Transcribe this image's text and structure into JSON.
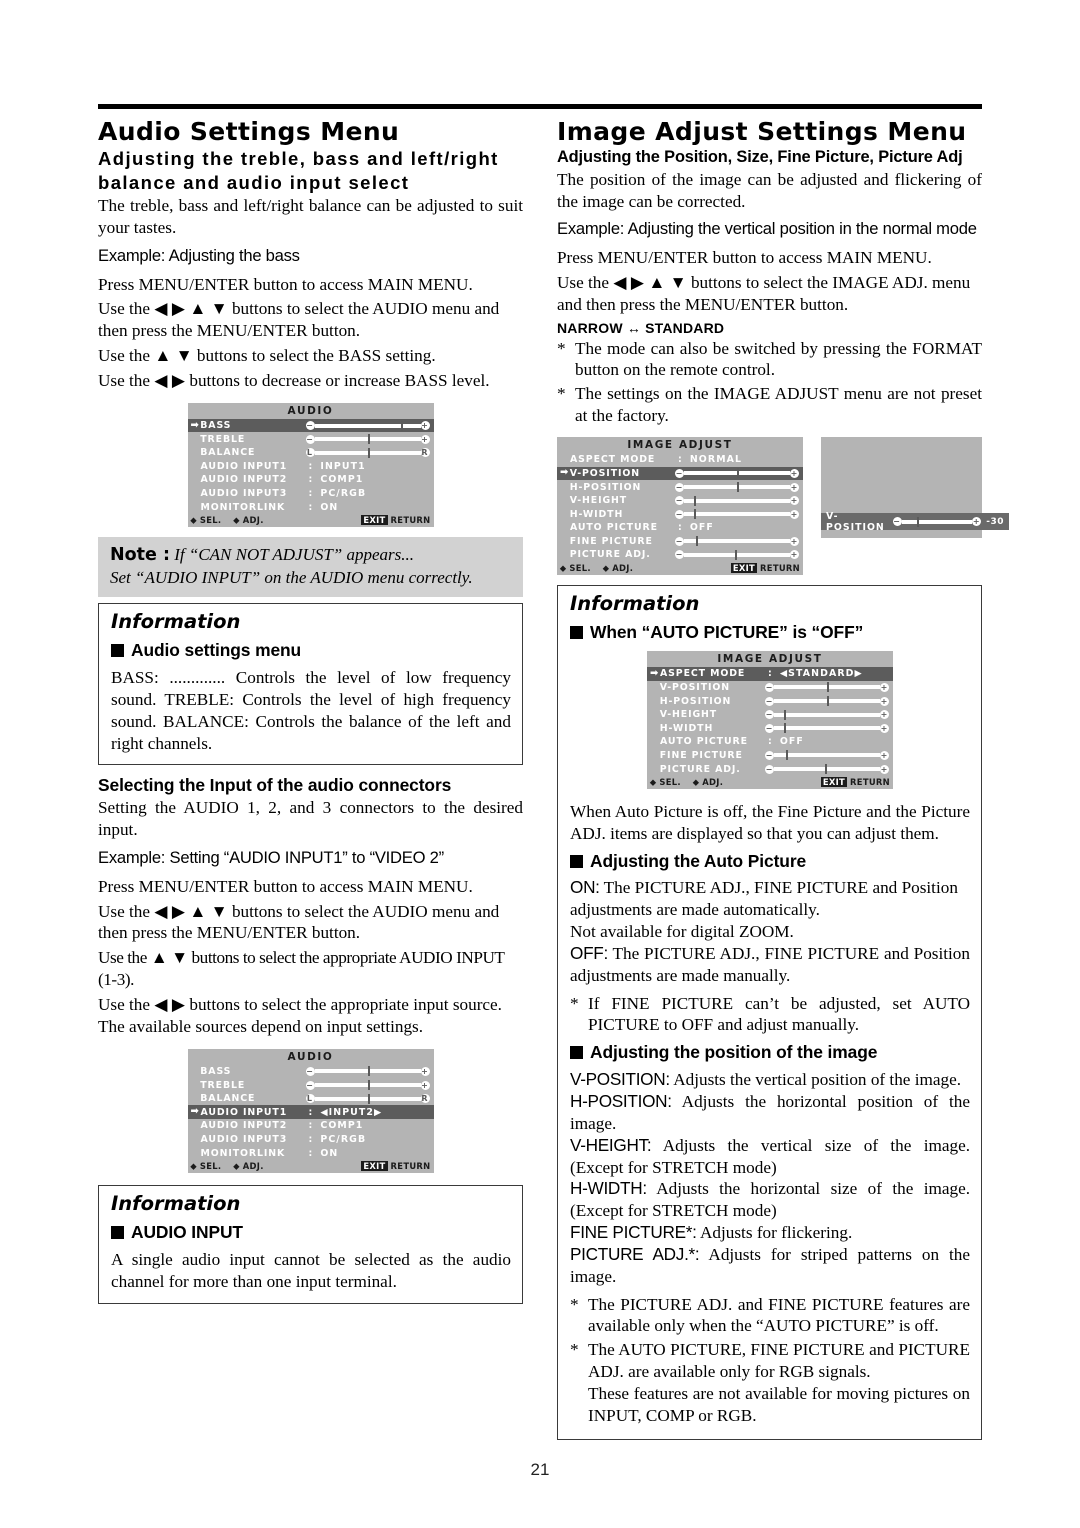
{
  "page": {
    "number": "21"
  },
  "left": {
    "title": "Audio Settings Menu",
    "subtitle_line1": "Adjusting the treble, bass and left/right",
    "subtitle_line2": "balance and audio input select",
    "intro": "The treble, bass and left/right balance can be adjusted to suit your tastes.",
    "example": "Example: Adjusting the bass",
    "steps": [
      "Press MENU/ENTER button to access MAIN MENU.",
      "Use the ◀ ▶ ▲ ▼ buttons to select the AUDIO menu and then press the MENU/ENTER button.",
      "Use the ▲ ▼ buttons to select the BASS setting.",
      "Use the ◀ ▶ buttons to decrease or increase BASS level."
    ],
    "note": {
      "label": "Note :",
      "line1": "If “CAN NOT ADJUST” appears...",
      "line2": "Set “AUDIO INPUT” on the AUDIO menu correctly."
    },
    "info1": {
      "title": "Information",
      "heading": "Audio settings menu",
      "body": "BASS: .............  Controls the level of low frequency sound.\nTREBLE: Controls the level of high frequency sound.\nBALANCE: Controls the balance of the left and right channels."
    },
    "section2": {
      "heading": "Selecting the Input of the audio connectors",
      "intro": "Setting the AUDIO 1, 2, and 3 connectors to the desired input.",
      "example": "Example: Setting “AUDIO INPUT1” to “VIDEO 2”",
      "steps": [
        "Press MENU/ENTER button to access MAIN MENU.",
        "Use the ◀ ▶ ▲ ▼ buttons to select the AUDIO menu and then press the MENU/ENTER button.",
        "Use the ▲ ▼ buttons to select the appropriate AUDIO INPUT (1-3).",
        "Use the ◀ ▶ buttons to select the appropriate input source. The available sources depend on input settings."
      ]
    },
    "info2": {
      "title": "Information",
      "heading": "AUDIO INPUT",
      "body": "A single audio input cannot be selected as the audio channel for more than one input terminal."
    }
  },
  "right": {
    "title": "Image Adjust Settings Menu",
    "subtitle": "Adjusting the Position, Size, Fine Picture, Picture Adj",
    "intro": "The position of the image can be adjusted and flickering of the image can be corrected.",
    "example": "Example: Adjusting the vertical position in the normal mode",
    "steps": [
      "Press MENU/ENTER button to access MAIN MENU.",
      "Use the ◀ ▶ ▲ ▼ buttons to select the IMAGE ADJ. menu and then press the MENU/ENTER button."
    ],
    "mode_note": "NARROW ↔ STANDARD",
    "notes": [
      "The mode can also be switched by pressing the FORMAT button on the remote control.",
      "The settings on the IMAGE ADJUST menu are not preset at the factory."
    ],
    "info3": {
      "title": "Information",
      "heading": "When “AUTO PICTURE” is “OFF”",
      "body": "When Auto Picture is off, the Fine Picture and the Picture ADJ. items are displayed so that you can adjust them.",
      "heading2": "Adjusting the Auto Picture",
      "auto_on_lead": "ON:",
      "auto_on": " The PICTURE ADJ., FINE PICTURE and Position adjustments are made automatically.",
      "auto_on2": "Not available for digital ZOOM.",
      "auto_off_lead": "OFF:",
      "auto_off": " The PICTURE ADJ., FINE PICTURE and Position adjustments are made manually.",
      "star1": "If FINE PICTURE can’t be adjusted, set AUTO PICTURE to OFF and adjust manually.",
      "heading3": "Adjusting the position of the image",
      "defs": [
        {
          "term": "V-POSITION:",
          "desc": " Adjusts the vertical position of the image."
        },
        {
          "term": "H-POSITION:",
          "desc": " Adjusts the horizontal position of the image."
        },
        {
          "term": "V-HEIGHT:",
          "desc": " Adjusts the vertical size of the image. (Except for STRETCH mode)"
        },
        {
          "term": "H-WIDTH:",
          "desc": " Adjusts the horizontal size of the image. (Except for STRETCH mode)"
        },
        {
          "term": "FINE PICTURE*:",
          "desc": " Adjusts for flickering."
        },
        {
          "term": "PICTURE ADJ.*:",
          "desc": " Adjusts for striped patterns on the image."
        }
      ],
      "star2": "The PICTURE ADJ. and FINE PICTURE features are available only when the “AUTO PICTURE” is off.",
      "star3": "The AUTO PICTURE, FINE PICTURE and PICTURE ADJ. are available only for RGB signals.",
      "star3b": "These features are not available for moving pictures on INPUT, COMP or RGB."
    }
  },
  "osd_audio_1": {
    "title": "AUDIO",
    "rows": [
      {
        "label": "BASS",
        "type": "slider",
        "selected": true,
        "left_cap": "−",
        "right_cap": "+",
        "pos": 82
      },
      {
        "label": "TREBLE",
        "type": "slider",
        "selected": false,
        "left_cap": "−",
        "right_cap": "+",
        "pos": 50
      },
      {
        "label": "BALANCE",
        "type": "slider",
        "selected": false,
        "left_cap": "L",
        "right_cap": "R",
        "pos": 50
      },
      {
        "label": "AUDIO INPUT1",
        "type": "value",
        "value": "INPUT1"
      },
      {
        "label": "AUDIO INPUT2",
        "type": "value",
        "value": "COMP1"
      },
      {
        "label": "AUDIO INPUT3",
        "type": "value",
        "value": "PC/RGB"
      },
      {
        "label": "MONITORLINK",
        "type": "value",
        "value": "ON"
      }
    ],
    "footer": {
      "sel": "SEL.",
      "adj": "ADJ.",
      "exit": "EXIT",
      "return": "RETURN"
    }
  },
  "osd_audio_2": {
    "title": "AUDIO",
    "rows": [
      {
        "label": "BASS",
        "type": "slider",
        "selected": false,
        "left_cap": "−",
        "right_cap": "+",
        "pos": 50
      },
      {
        "label": "TREBLE",
        "type": "slider",
        "selected": false,
        "left_cap": "−",
        "right_cap": "+",
        "pos": 50
      },
      {
        "label": "BALANCE",
        "type": "slider",
        "selected": false,
        "left_cap": "L",
        "right_cap": "R",
        "pos": 50
      },
      {
        "label": "AUDIO INPUT1",
        "type": "value",
        "value": "INPUT2",
        "selected": true,
        "adjustable": true
      },
      {
        "label": "AUDIO INPUT2",
        "type": "value",
        "value": "COMP1"
      },
      {
        "label": "AUDIO INPUT3",
        "type": "value",
        "value": "PC/RGB"
      },
      {
        "label": "MONITORLINK",
        "type": "value",
        "value": "ON"
      }
    ],
    "footer": {
      "sel": "SEL.",
      "adj": "ADJ.",
      "exit": "EXIT",
      "return": "RETURN"
    }
  },
  "osd_image_1": {
    "title": "IMAGE ADJUST",
    "rows": [
      {
        "label": "ASPECT MODE",
        "type": "value",
        "value": "NORMAL"
      },
      {
        "label": "V-POSITION",
        "type": "slider",
        "selected": true,
        "left_cap": "−",
        "right_cap": "+",
        "pos": 50
      },
      {
        "label": "H-POSITION",
        "type": "slider",
        "selected": false,
        "left_cap": "−",
        "right_cap": "+",
        "pos": 50
      },
      {
        "label": "V-HEIGHT",
        "type": "slider",
        "selected": false,
        "left_cap": "−",
        "right_cap": "+",
        "pos": 9
      },
      {
        "label": "H-WIDTH",
        "type": "slider",
        "selected": false,
        "left_cap": "−",
        "right_cap": "+",
        "pos": 9
      },
      {
        "label": "AUTO PICTURE",
        "type": "value",
        "value": "OFF"
      },
      {
        "label": "FINE PICTURE",
        "type": "slider",
        "selected": false,
        "left_cap": "−",
        "right_cap": "+",
        "pos": 11
      },
      {
        "label": "PICTURE ADJ.",
        "type": "slider",
        "selected": false,
        "left_cap": "−",
        "right_cap": "+",
        "pos": 48
      }
    ],
    "footer": {
      "sel": "SEL.",
      "adj": "ADJ.",
      "exit": "EXIT",
      "return": "RETURN"
    }
  },
  "osd_vpos": {
    "label": "V-POSITION",
    "left_cap": "−",
    "right_cap": "+",
    "pos": 22,
    "value": "-30"
  },
  "osd_image_2": {
    "title": "IMAGE ADJUST",
    "rows": [
      {
        "label": "ASPECT MODE",
        "type": "value",
        "value": "STANDARD",
        "selected": true,
        "adjustable": true
      },
      {
        "label": "V-POSITION",
        "type": "slider",
        "selected": false,
        "left_cap": "−",
        "right_cap": "+",
        "pos": 50
      },
      {
        "label": "H-POSITION",
        "type": "slider",
        "selected": false,
        "left_cap": "−",
        "right_cap": "+",
        "pos": 50
      },
      {
        "label": "V-HEIGHT",
        "type": "slider",
        "selected": false,
        "left_cap": "−",
        "right_cap": "+",
        "pos": 9
      },
      {
        "label": "H-WIDTH",
        "type": "slider",
        "selected": false,
        "left_cap": "−",
        "right_cap": "+",
        "pos": 9
      },
      {
        "label": "AUTO PICTURE",
        "type": "value",
        "value": "OFF"
      },
      {
        "label": "FINE PICTURE",
        "type": "slider",
        "selected": false,
        "left_cap": "−",
        "right_cap": "+",
        "pos": 11
      },
      {
        "label": "PICTURE ADJ.",
        "type": "slider",
        "selected": false,
        "left_cap": "−",
        "right_cap": "+",
        "pos": 48
      }
    ],
    "footer": {
      "sel": "SEL.",
      "adj": "ADJ.",
      "exit": "EXIT",
      "return": "RETURN"
    }
  }
}
